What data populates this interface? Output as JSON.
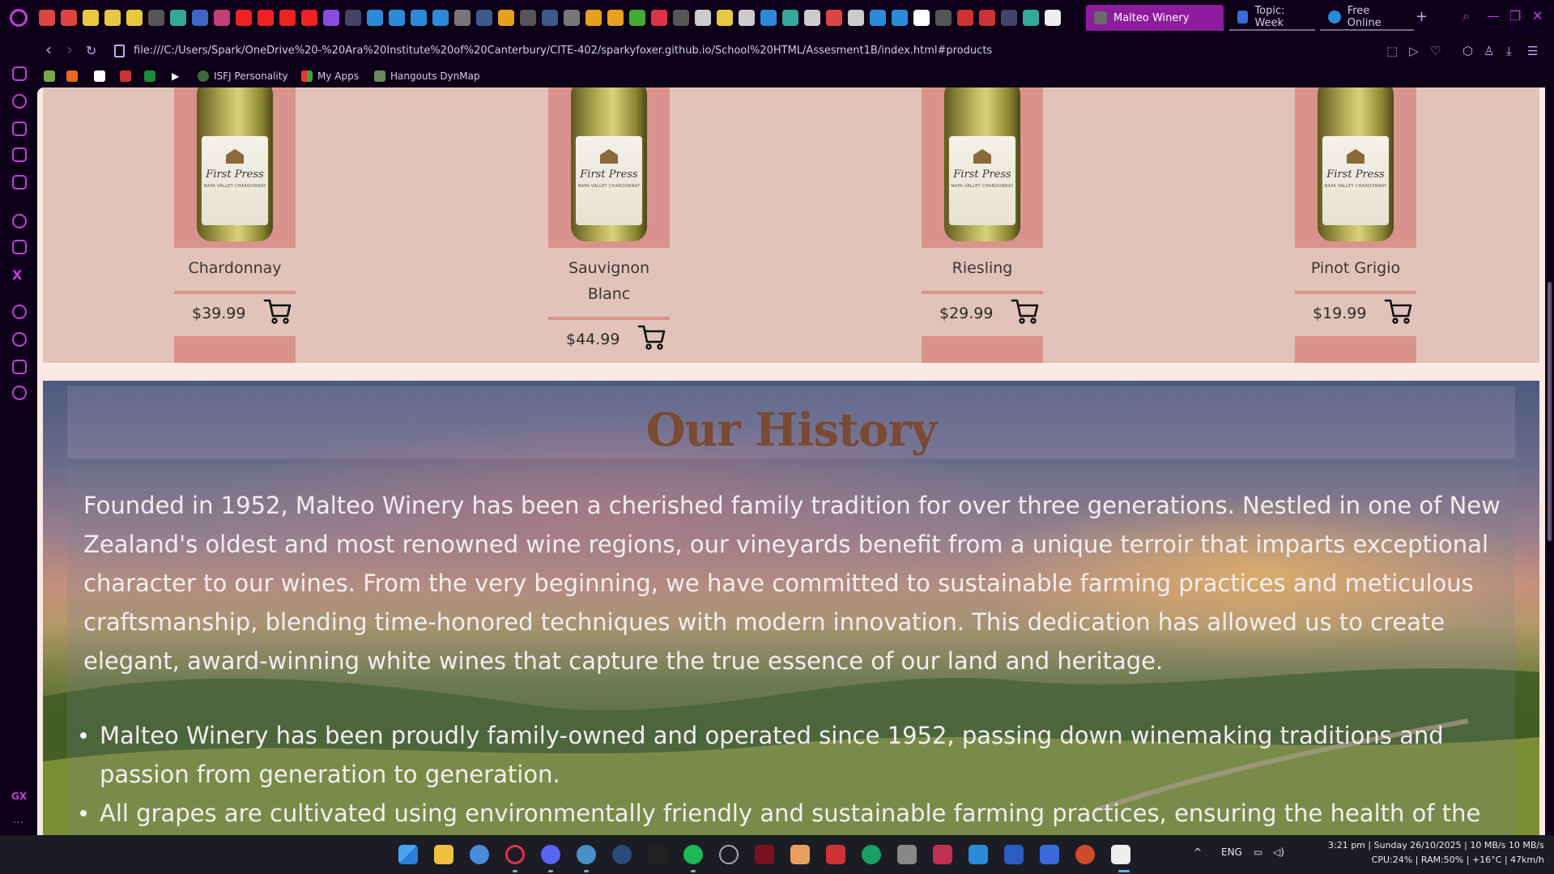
{
  "browser": {
    "tabs": [
      {
        "label": "Malteo Winery",
        "active": true
      },
      {
        "label": "Topic: Week",
        "active": false
      },
      {
        "label": "Free Online",
        "active": false
      }
    ],
    "new_tab": "+",
    "window_controls": {
      "search": "⌕",
      "minimize": "—",
      "restore": "❐",
      "close": "✕"
    },
    "url": "file:///C:/Users/Spark/OneDrive%20-%20Ara%20Institute%20of%20Canterbury/CITE-402/sparkyfoxer.github.io/School%20HTML/Assesment1B/index.html#products",
    "nav": {
      "back": "‹",
      "forward": "›",
      "reload": "↻"
    },
    "bookmarks": [
      {
        "label": "ISFJ Personality"
      },
      {
        "label": "My Apps"
      },
      {
        "label": "Hangouts DynMap"
      }
    ],
    "sidebar": {
      "gx": "GX",
      "more": "···"
    }
  },
  "products": [
    {
      "name": "Chardonnay",
      "price": "$39.99",
      "label_brand": "First Press",
      "label_sub": "NAPA VALLEY CHARDONNAY"
    },
    {
      "name": "Sauvignon Blanc",
      "price": "$44.99",
      "label_brand": "First Press",
      "label_sub": "NAPA VALLEY CHARDONNAY"
    },
    {
      "name": "Riesling",
      "price": "$29.99",
      "label_brand": "First Press",
      "label_sub": "NAPA VALLEY CHARDONNAY"
    },
    {
      "name": "Pinot Grigio",
      "price": "$19.99",
      "label_brand": "First Press",
      "label_sub": "NAPA VALLEY CHARDONNAY"
    }
  ],
  "history": {
    "title": "Our History",
    "paragraph": "Founded in 1952, Malteo Winery has been a cherished family tradition for over three generations. Nestled in one of New Zealand's oldest and most renowned wine regions, our vineyards benefit from a unique terroir that imparts exceptional character to our wines. From the very beginning, we have committed to sustainable farming practices and meticulous craftsmanship, blending time-honored techniques with modern innovation. This dedication has allowed us to create elegant, award-winning white wines that capture the true essence of our land and heritage.",
    "bullets": [
      "Malteo Winery has been proudly family-owned and operated since 1952, passing down winemaking traditions and passion from generation to generation.",
      "All grapes are cultivated using environmentally friendly and sustainable farming practices, ensuring the health of the land"
    ]
  },
  "taskbar": {
    "language": "ENG",
    "time": "3:21 pm",
    "date": "Sunday 26/10/2025",
    "net": "10 MB/s",
    "net2": "10 MB/s",
    "stats": "CPU:24% | RAM:50% | +16°C | 47km/h"
  }
}
